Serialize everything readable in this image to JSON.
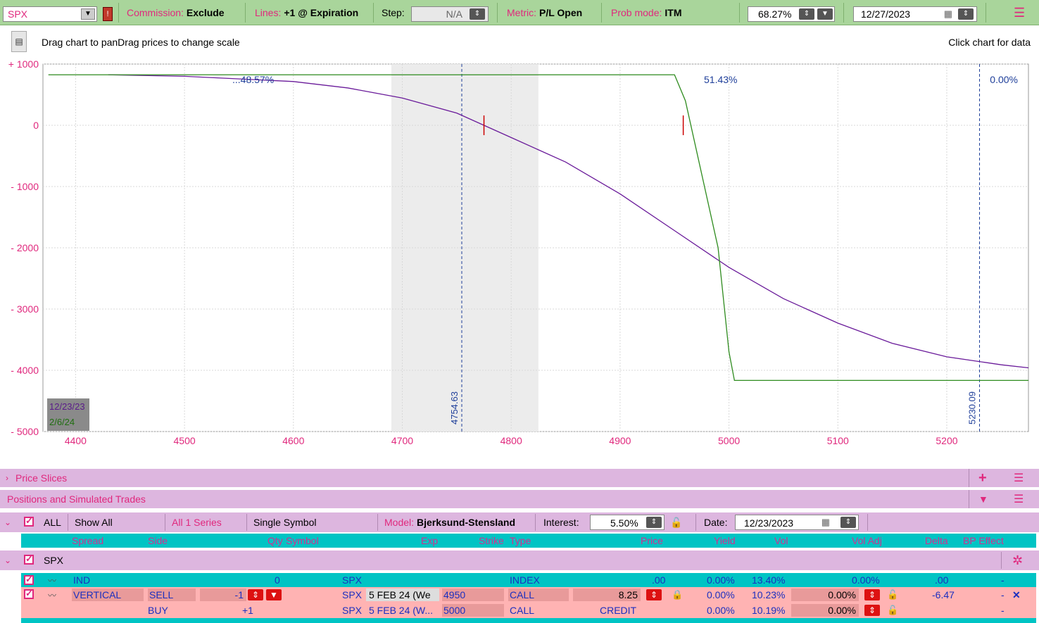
{
  "toolbar": {
    "symbol": "SPX",
    "commission_label": "Commission:",
    "commission_value": "Exclude",
    "lines_label": "Lines:",
    "lines_value": "+1 @ Expiration",
    "step_label": "Step:",
    "step_value": "N/A",
    "metric_label": "Metric:",
    "metric_value": "P/L Open",
    "prob_label": "Prob mode:",
    "prob_value": "ITM",
    "prob_pct": "68.27%",
    "date": "12/27/2023"
  },
  "chart_header": {
    "drag_text": "Drag chart to panDrag prices to change scale",
    "click_text": "Click chart for data"
  },
  "chart_data": {
    "type": "line",
    "xlim": [
      4370,
      5275
    ],
    "ylim": [
      -5000,
      1000
    ],
    "x_ticks": [
      4400,
      4500,
      4600,
      4700,
      4800,
      4900,
      5000,
      5100,
      5200
    ],
    "y_ticks": [
      "+ 1000",
      "0",
      "- 1000",
      "- 2000",
      "- 3000",
      "- 4000",
      "- 5000"
    ],
    "y_tick_values": [
      1000,
      0,
      -1000,
      -2000,
      -3000,
      -4000,
      -5000
    ],
    "series": [
      {
        "name": "12/23/23",
        "color": "#6a1b9a",
        "x": [
          4430,
          4500,
          4600,
          4650,
          4700,
          4750,
          4800,
          4850,
          4900,
          4950,
          5000,
          5050,
          5100,
          5150,
          5200,
          5250,
          5275
        ],
        "y": [
          825,
          800,
          715,
          610,
          445,
          200,
          -200,
          -600,
          -1120,
          -1720,
          -2320,
          -2830,
          -3230,
          -3560,
          -3780,
          -3910,
          -3960
        ]
      },
      {
        "name": "2/6/24",
        "color": "#2e8b1e",
        "x": [
          4375,
          4950,
          4960,
          4990,
          5000,
          5005,
          5275
        ],
        "y": [
          825,
          825,
          400,
          -2000,
          -3700,
          -4165,
          -4165
        ]
      }
    ],
    "vlines": [
      {
        "x": 4754.63,
        "label": "4754.63"
      },
      {
        "x": 5230.09,
        "label": "5230.09"
      }
    ],
    "shaded_range": [
      4690,
      4825
    ],
    "annotations": [
      "48.57%",
      "51.43%",
      "0.00%"
    ],
    "legend_placement": "bottom-left",
    "grid": true
  },
  "panels": {
    "price_slices": "Price Slices",
    "positions": "Positions and Simulated Trades"
  },
  "filters": {
    "all": "ALL",
    "show_all": "Show All",
    "series": "All 1 Series",
    "single_symbol": "Single Symbol",
    "model_label": "Model:",
    "model_value": "Bjerksund-Stensland",
    "interest_label": "Interest:",
    "interest_value": "5.50%",
    "date_label": "Date:",
    "date_value": "12/23/2023"
  },
  "columns": [
    "Spread",
    "Side",
    "Qty",
    "Symbol",
    "Exp",
    "Strike",
    "Type",
    "Price",
    "Yield",
    "Vol",
    "Vol Adj",
    "Delta",
    "BP Effect"
  ],
  "group": "SPX",
  "rows": [
    {
      "spread": "IND",
      "side": "",
      "qty": "0",
      "symbol": "SPX",
      "exp": "",
      "strike": "",
      "type": "INDEX",
      "price": ".00",
      "yield": "0.00%",
      "vol": "13.40%",
      "voladj": "0.00%",
      "delta": ".00",
      "bp": "-"
    },
    {
      "spread": "VERTICAL",
      "side": "SELL",
      "qty": "-1",
      "symbol": "SPX",
      "exp": "5 FEB 24 (We",
      "strike": "4950",
      "type": "CALL",
      "price": "8.25",
      "yield": "0.00%",
      "vol": "10.23%",
      "voladj": "0.00%",
      "delta": "-6.47",
      "bp": "-"
    },
    {
      "spread": "",
      "side": "BUY",
      "qty": "+1",
      "symbol": "SPX",
      "exp": "5 FEB 24 (W...",
      "strike": "5000",
      "type": "CALL",
      "price": "CREDIT",
      "yield": "0.00%",
      "vol": "10.19%",
      "voladj": "0.00%",
      "delta": "",
      "bp": "-"
    }
  ]
}
